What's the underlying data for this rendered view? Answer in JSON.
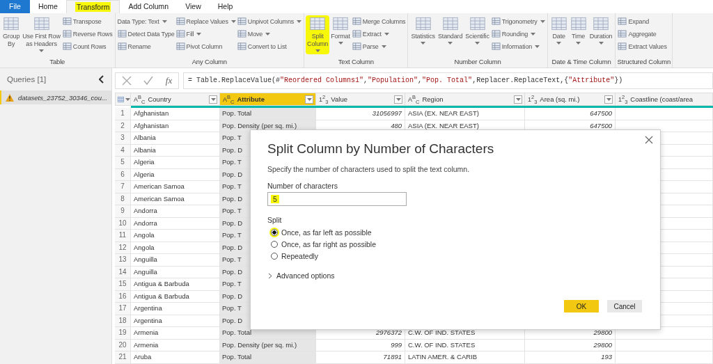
{
  "ribbon_tabs": [
    {
      "label": "File",
      "kind": "file",
      "selected": false,
      "highlighted": false
    },
    {
      "label": "Home",
      "kind": "tab",
      "selected": false,
      "highlighted": false
    },
    {
      "label": "Transform",
      "kind": "tab",
      "selected": true,
      "highlighted": true
    },
    {
      "label": "Add Column",
      "kind": "tab",
      "selected": false,
      "highlighted": false
    },
    {
      "label": "View",
      "kind": "tab",
      "selected": false,
      "highlighted": false
    },
    {
      "label": "Help",
      "kind": "tab",
      "selected": false,
      "highlighted": false
    }
  ],
  "ribbon_groups": [
    {
      "label": "Table",
      "items": [
        {
          "kind": "large",
          "label": "Group\nBy",
          "dropdown": false,
          "highlighted": false
        },
        {
          "kind": "large",
          "label": "Use First Row\nas Headers",
          "dropdown": true,
          "highlighted": false
        },
        {
          "kind": "stack",
          "items": [
            {
              "kind": "icon",
              "label": "Transpose",
              "dropdown": false
            },
            {
              "kind": "icon",
              "label": "Reverse Rows",
              "dropdown": false
            },
            {
              "kind": "icon",
              "label": "Count Rows",
              "dropdown": false
            }
          ]
        }
      ]
    },
    {
      "label": "Any Column",
      "items": [
        {
          "kind": "stack",
          "items": [
            {
              "kind": "plain",
              "label": "Data Type: Text",
              "dropdown": true
            },
            {
              "kind": "icon",
              "label": "Detect Data Type",
              "dropdown": false
            },
            {
              "kind": "icon",
              "label": "Rename",
              "dropdown": false
            }
          ]
        },
        {
          "kind": "stack",
          "items": [
            {
              "kind": "icon",
              "label": "Replace Values",
              "dropdown": true
            },
            {
              "kind": "icon",
              "label": "Fill",
              "dropdown": true
            },
            {
              "kind": "icon",
              "label": "Pivot Column",
              "dropdown": false
            }
          ]
        },
        {
          "kind": "stack",
          "items": [
            {
              "kind": "icon",
              "label": "Unpivot Columns",
              "dropdown": true
            },
            {
              "kind": "icon",
              "label": "Move",
              "dropdown": true
            },
            {
              "kind": "icon",
              "label": "Convert to List",
              "dropdown": false
            }
          ]
        }
      ]
    },
    {
      "label": "Text Column",
      "items": [
        {
          "kind": "large",
          "label": "Split\nColumn",
          "dropdown": true,
          "highlighted": true
        },
        {
          "kind": "large",
          "label": "Format",
          "dropdown": true,
          "highlighted": false
        },
        {
          "kind": "stack",
          "items": [
            {
              "kind": "icon",
              "label": "Merge Columns",
              "dropdown": false
            },
            {
              "kind": "icon",
              "label": "Extract",
              "dropdown": true
            },
            {
              "kind": "icon",
              "label": "Parse",
              "dropdown": true
            }
          ]
        }
      ]
    },
    {
      "label": "Number Column",
      "items": [
        {
          "kind": "large",
          "label": "Statistics",
          "dropdown": true,
          "highlighted": false
        },
        {
          "kind": "large",
          "label": "Standard",
          "dropdown": true,
          "highlighted": false
        },
        {
          "kind": "large",
          "label": "Scientific",
          "dropdown": true,
          "highlighted": false
        },
        {
          "kind": "stack",
          "items": [
            {
              "kind": "icon",
              "label": "Trigonometry",
              "dropdown": true
            },
            {
              "kind": "icon",
              "label": "Rounding",
              "dropdown": true
            },
            {
              "kind": "icon",
              "label": "Information",
              "dropdown": true
            }
          ]
        }
      ]
    },
    {
      "label": "Date & Time Column",
      "items": [
        {
          "kind": "large",
          "label": "Date",
          "dropdown": true,
          "highlighted": false
        },
        {
          "kind": "large",
          "label": "Time",
          "dropdown": true,
          "highlighted": false
        },
        {
          "kind": "large",
          "label": "Duration",
          "dropdown": true,
          "highlighted": false
        }
      ]
    },
    {
      "label": "Structured Column",
      "items": [
        {
          "kind": "stack",
          "items": [
            {
              "kind": "icon",
              "label": "Expand",
              "dropdown": false
            },
            {
              "kind": "icon",
              "label": "Aggregate",
              "dropdown": false
            },
            {
              "kind": "icon",
              "label": "Extract Values",
              "dropdown": false
            }
          ]
        }
      ]
    }
  ],
  "queries_pane": {
    "title": "Queries [1]",
    "items": [
      {
        "label": "datasets_23752_30346_cou...",
        "warning": true,
        "selected": true
      }
    ]
  },
  "formula_bar": {
    "fx_label": "fx",
    "formula": "= Table.ReplaceValue(#\"Reordered Columns1\",\"Population\",\"Pop. Total\",Replacer.ReplaceText,{\"Attribute\"})"
  },
  "table": {
    "columns": [
      {
        "type_label": "A$^{B}$$_{C}$",
        "name": "Country",
        "selected": false,
        "filter": true,
        "kind": "text"
      },
      {
        "type_label": "A$^{B}$$_{C}$",
        "name": "Attribute",
        "selected": true,
        "filter": true,
        "kind": "text"
      },
      {
        "type_label": "1$^{2}$$_{3}$",
        "name": "Value",
        "selected": false,
        "filter": true,
        "kind": "number"
      },
      {
        "type_label": "A$^{B}$$_{C}$",
        "name": "Region",
        "selected": false,
        "filter": true,
        "kind": "text"
      },
      {
        "type_label": "1$^{2}$$_{3}$",
        "name": "Area (sq. mi.)",
        "selected": false,
        "filter": true,
        "kind": "number"
      },
      {
        "type_label": "1$^{2}$$_{3}$",
        "name": "Coastline (coast/area",
        "selected": false,
        "filter": false,
        "kind": "number"
      }
    ],
    "rows": [
      {
        "number": "1",
        "cells": [
          "Afghanistan",
          "Pop. Total",
          "31056997",
          "ASIA (EX. NEAR EAST)",
          "647500"
        ]
      },
      {
        "number": "2",
        "cells": [
          "Afghanistan",
          "Pop. Density (per sq. mi.)",
          "480",
          "ASIA (EX. NEAR EAST)",
          "647500"
        ]
      },
      {
        "number": "3",
        "cells": [
          "Albania",
          "Pop. T"
        ]
      },
      {
        "number": "4",
        "cells": [
          "Albania",
          "Pop. D"
        ]
      },
      {
        "number": "5",
        "cells": [
          "Algeria",
          "Pop. T"
        ]
      },
      {
        "number": "6",
        "cells": [
          "Algeria",
          "Pop. D"
        ]
      },
      {
        "number": "7",
        "cells": [
          "American Samoa",
          "Pop. T"
        ]
      },
      {
        "number": "8",
        "cells": [
          "American Samoa",
          "Pop. D"
        ]
      },
      {
        "number": "9",
        "cells": [
          "Andorra",
          "Pop. T"
        ]
      },
      {
        "number": "10",
        "cells": [
          "Andorra",
          "Pop. D"
        ]
      },
      {
        "number": "11",
        "cells": [
          "Angola",
          "Pop. T"
        ]
      },
      {
        "number": "12",
        "cells": [
          "Angola",
          "Pop. D"
        ]
      },
      {
        "number": "13",
        "cells": [
          "Anguilla",
          "Pop. T"
        ]
      },
      {
        "number": "14",
        "cells": [
          "Anguilla",
          "Pop. D"
        ]
      },
      {
        "number": "15",
        "cells": [
          "Antigua & Barbuda",
          "Pop. T"
        ]
      },
      {
        "number": "16",
        "cells": [
          "Antigua & Barbuda",
          "Pop. D"
        ]
      },
      {
        "number": "17",
        "cells": [
          "Argentina",
          "Pop. T"
        ]
      },
      {
        "number": "18",
        "cells": [
          "Argentina",
          "Pop. D"
        ]
      },
      {
        "number": "19",
        "cells": [
          "Armenia",
          "Pop. Total",
          "2976372",
          "C.W. OF IND. STATES",
          "29800"
        ]
      },
      {
        "number": "20",
        "cells": [
          "Armenia",
          "Pop. Density (per sq. mi.)",
          "999",
          "C.W. OF IND. STATES",
          "29800"
        ]
      },
      {
        "number": "21",
        "cells": [
          "Aruba",
          "Pop. Total",
          "71891",
          "LATIN AMER. & CARIB",
          "193"
        ]
      }
    ]
  },
  "dialog": {
    "title": "Split Column by Number of Characters",
    "description": "Specify the number of characters used to split the text column.",
    "field_label": "Number of characters",
    "field_value": "5",
    "field_highlighted": true,
    "split_label": "Split",
    "options": [
      {
        "label": "Once, as far left as possible",
        "selected": true,
        "highlighted": true
      },
      {
        "label": "Once, as far right as possible",
        "selected": false,
        "highlighted": false
      },
      {
        "label": "Repeatedly",
        "selected": false,
        "highlighted": false
      }
    ],
    "advanced": {
      "label": "Advanced options",
      "expanded": false
    },
    "buttons": [
      {
        "label": "OK",
        "kind": "primary"
      },
      {
        "label": "Cancel",
        "kind": "secondary"
      }
    ]
  }
}
